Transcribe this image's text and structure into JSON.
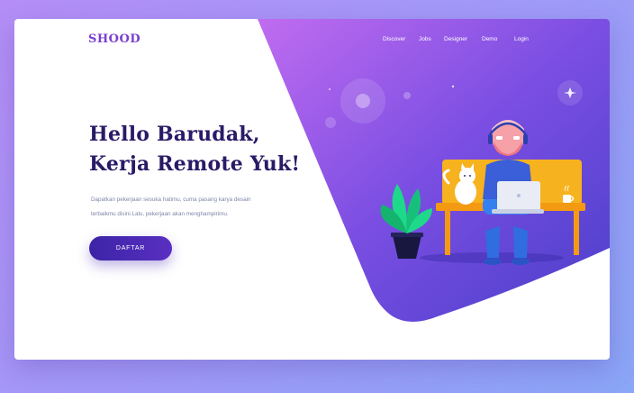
{
  "brand": {
    "logo": "SHOOD"
  },
  "nav": {
    "items": [
      "Discover",
      "Jobs",
      "Designer",
      "Demo",
      "Login"
    ]
  },
  "hero": {
    "headline_line1": "Hello Barudak,",
    "headline_line2": "Kerja Remote Yuk!",
    "description_line1": "Dapatkan pekerjaan sesuka hatimu, cuma pasang karya desain",
    "description_line2": "terbaikmu disini.Lalu, pekerjaan akan menghampirimu.",
    "cta_label": "DAFTAR"
  },
  "colors": {
    "accent_purple": "#5a2fc2",
    "headline_navy": "#2a1a67",
    "bench_yellow": "#f7b21f",
    "plant_green": "#1ed98a"
  },
  "icons": [
    "sparkle-icon",
    "person-illustration",
    "cat-illustration",
    "plant-illustration",
    "laptop-illustration",
    "mug-illustration"
  ]
}
